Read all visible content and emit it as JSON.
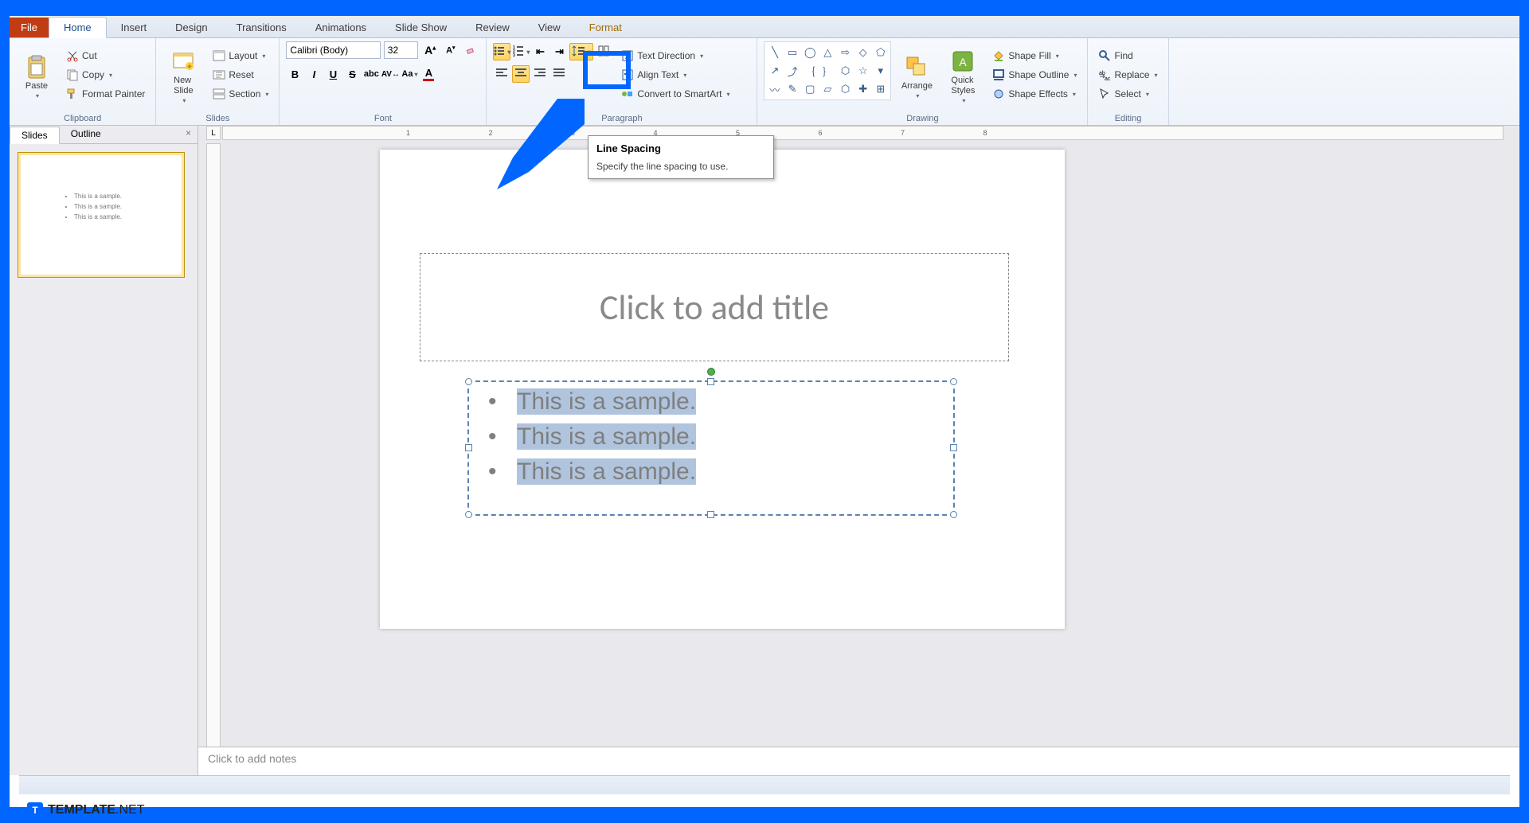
{
  "tabs": {
    "file": "File",
    "home": "Home",
    "insert": "Insert",
    "design": "Design",
    "transitions": "Transitions",
    "animations": "Animations",
    "slideshow": "Slide Show",
    "review": "Review",
    "view": "View",
    "format": "Format"
  },
  "ribbon": {
    "clipboard": {
      "label": "Clipboard",
      "paste": "Paste",
      "cut": "Cut",
      "copy": "Copy",
      "format_painter": "Format Painter"
    },
    "slides": {
      "label": "Slides",
      "new_slide": "New\nSlide",
      "layout": "Layout",
      "reset": "Reset",
      "section": "Section"
    },
    "font": {
      "label": "Font",
      "family": "Calibri (Body)",
      "size": "32"
    },
    "paragraph": {
      "label": "Paragraph",
      "text_direction": "Text Direction",
      "align_text": "Align Text",
      "convert_smartart": "Convert to SmartArt"
    },
    "drawing": {
      "label": "Drawing",
      "arrange": "Arrange",
      "quick_styles": "Quick\nStyles",
      "shape_fill": "Shape Fill",
      "shape_outline": "Shape Outline",
      "shape_effects": "Shape Effects"
    },
    "editing": {
      "label": "Editing",
      "find": "Find",
      "replace": "Replace",
      "select": "Select"
    }
  },
  "tooltip": {
    "title": "Line Spacing",
    "body": "Specify the line spacing to use."
  },
  "left_pane": {
    "tab_slides": "Slides",
    "tab_outline": "Outline",
    "thumb_lines": [
      "This is a sample.",
      "This is a sample.",
      "This is a sample."
    ]
  },
  "slide": {
    "title_placeholder": "Click to add title",
    "bullets": [
      "This is a sample.",
      "This is a sample.",
      "This is a sample."
    ]
  },
  "notes_placeholder": "Click to add notes",
  "ruler_corner": "L",
  "watermark": {
    "badge": "T",
    "brand": "TEMPLATE",
    "suffix": ".NET"
  }
}
